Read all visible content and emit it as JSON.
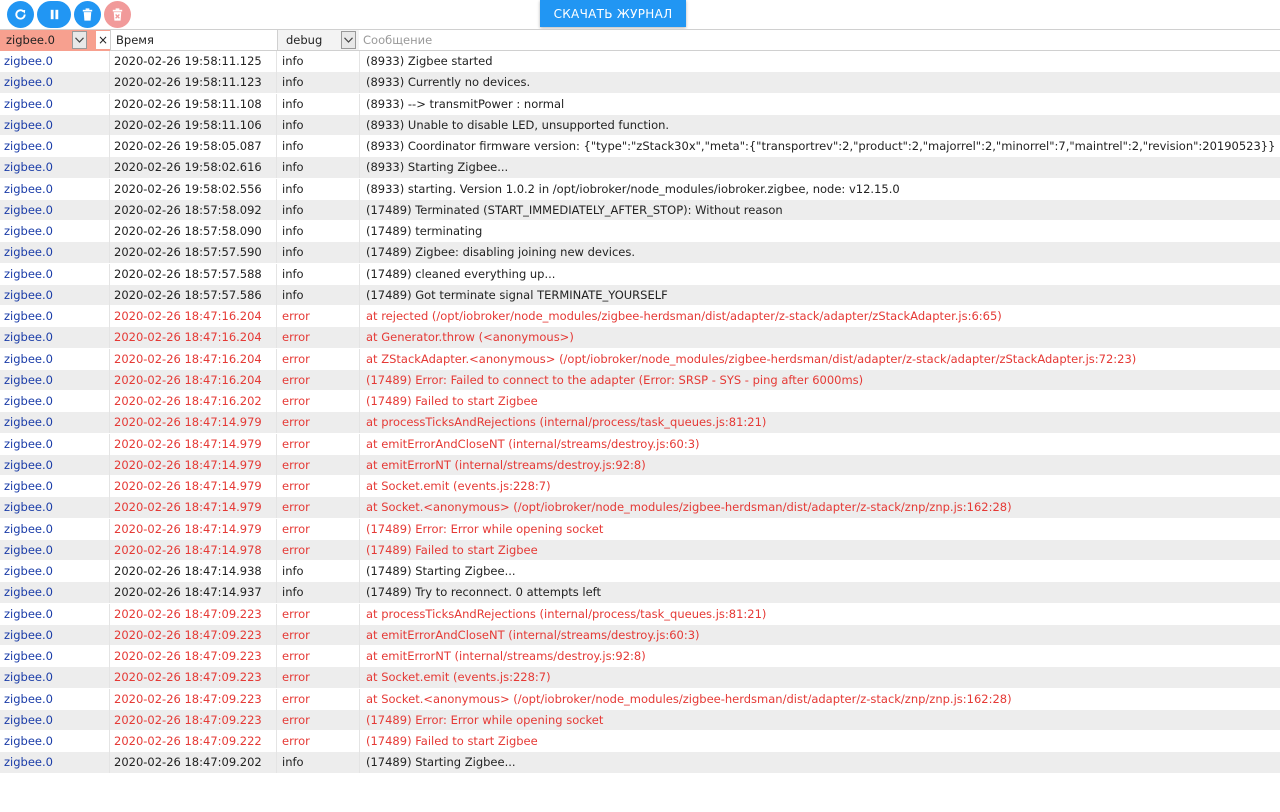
{
  "toolbar": {
    "download_label": "СКАЧАТЬ ЖУРНАЛ",
    "accent_color": "#2196f3",
    "delete_color": "#f19a9a",
    "icons": [
      "refresh-icon",
      "pause-icon",
      "trash-icon",
      "trash-cancel-icon"
    ]
  },
  "filters": {
    "source_value": "zigbee.0",
    "clear_glyph": "×",
    "time_header": "Время",
    "level_value": "debug",
    "message_placeholder": "Сообщение"
  },
  "colors": {
    "error": "#e53935",
    "source": "#1a3ca8"
  },
  "rows": [
    {
      "src": "zigbee.0",
      "time": "2020-02-26 19:58:11.125",
      "level": "info",
      "msg": "(8933) Zigbee started"
    },
    {
      "src": "zigbee.0",
      "time": "2020-02-26 19:58:11.123",
      "level": "info",
      "msg": "(8933) Currently no devices."
    },
    {
      "src": "zigbee.0",
      "time": "2020-02-26 19:58:11.108",
      "level": "info",
      "msg": "(8933) --> transmitPower : normal"
    },
    {
      "src": "zigbee.0",
      "time": "2020-02-26 19:58:11.106",
      "level": "info",
      "msg": "(8933) Unable to disable LED, unsupported function."
    },
    {
      "src": "zigbee.0",
      "time": "2020-02-26 19:58:05.087",
      "level": "info",
      "msg": "(8933) Coordinator firmware version: {\"type\":\"zStack30x\",\"meta\":{\"transportrev\":2,\"product\":2,\"majorrel\":2,\"minorrel\":7,\"maintrel\":2,\"revision\":20190523}}"
    },
    {
      "src": "zigbee.0",
      "time": "2020-02-26 19:58:02.616",
      "level": "info",
      "msg": "(8933) Starting Zigbee..."
    },
    {
      "src": "zigbee.0",
      "time": "2020-02-26 19:58:02.556",
      "level": "info",
      "msg": "(8933) starting. Version 1.0.2 in /opt/iobroker/node_modules/iobroker.zigbee, node: v12.15.0"
    },
    {
      "src": "zigbee.0",
      "time": "2020-02-26 18:57:58.092",
      "level": "info",
      "msg": "(17489) Terminated (START_IMMEDIATELY_AFTER_STOP): Without reason"
    },
    {
      "src": "zigbee.0",
      "time": "2020-02-26 18:57:58.090",
      "level": "info",
      "msg": "(17489) terminating"
    },
    {
      "src": "zigbee.0",
      "time": "2020-02-26 18:57:57.590",
      "level": "info",
      "msg": "(17489) Zigbee: disabling joining new devices."
    },
    {
      "src": "zigbee.0",
      "time": "2020-02-26 18:57:57.588",
      "level": "info",
      "msg": "(17489) cleaned everything up..."
    },
    {
      "src": "zigbee.0",
      "time": "2020-02-26 18:57:57.586",
      "level": "info",
      "msg": "(17489) Got terminate signal TERMINATE_YOURSELF"
    },
    {
      "src": "zigbee.0",
      "time": "2020-02-26 18:47:16.204",
      "level": "error",
      "msg": "at rejected (/opt/iobroker/node_modules/zigbee-herdsman/dist/adapter/z-stack/adapter/zStackAdapter.js:6:65)"
    },
    {
      "src": "zigbee.0",
      "time": "2020-02-26 18:47:16.204",
      "level": "error",
      "msg": "at Generator.throw (<anonymous>)"
    },
    {
      "src": "zigbee.0",
      "time": "2020-02-26 18:47:16.204",
      "level": "error",
      "msg": "at ZStackAdapter.<anonymous> (/opt/iobroker/node_modules/zigbee-herdsman/dist/adapter/z-stack/adapter/zStackAdapter.js:72:23)"
    },
    {
      "src": "zigbee.0",
      "time": "2020-02-26 18:47:16.204",
      "level": "error",
      "msg": "(17489) Error: Failed to connect to the adapter (Error: SRSP - SYS - ping after 6000ms)"
    },
    {
      "src": "zigbee.0",
      "time": "2020-02-26 18:47:16.202",
      "level": "error",
      "msg": "(17489) Failed to start Zigbee"
    },
    {
      "src": "zigbee.0",
      "time": "2020-02-26 18:47:14.979",
      "level": "error",
      "msg": "at processTicksAndRejections (internal/process/task_queues.js:81:21)"
    },
    {
      "src": "zigbee.0",
      "time": "2020-02-26 18:47:14.979",
      "level": "error",
      "msg": "at emitErrorAndCloseNT (internal/streams/destroy.js:60:3)"
    },
    {
      "src": "zigbee.0",
      "time": "2020-02-26 18:47:14.979",
      "level": "error",
      "msg": "at emitErrorNT (internal/streams/destroy.js:92:8)"
    },
    {
      "src": "zigbee.0",
      "time": "2020-02-26 18:47:14.979",
      "level": "error",
      "msg": "at Socket.emit (events.js:228:7)"
    },
    {
      "src": "zigbee.0",
      "time": "2020-02-26 18:47:14.979",
      "level": "error",
      "msg": "at Socket.<anonymous> (/opt/iobroker/node_modules/zigbee-herdsman/dist/adapter/z-stack/znp/znp.js:162:28)"
    },
    {
      "src": "zigbee.0",
      "time": "2020-02-26 18:47:14.979",
      "level": "error",
      "msg": "(17489) Error: Error while opening socket"
    },
    {
      "src": "zigbee.0",
      "time": "2020-02-26 18:47:14.978",
      "level": "error",
      "msg": "(17489) Failed to start Zigbee"
    },
    {
      "src": "zigbee.0",
      "time": "2020-02-26 18:47:14.938",
      "level": "info",
      "msg": "(17489) Starting Zigbee..."
    },
    {
      "src": "zigbee.0",
      "time": "2020-02-26 18:47:14.937",
      "level": "info",
      "msg": "(17489) Try to reconnect. 0 attempts left"
    },
    {
      "src": "zigbee.0",
      "time": "2020-02-26 18:47:09.223",
      "level": "error",
      "msg": "at processTicksAndRejections (internal/process/task_queues.js:81:21)"
    },
    {
      "src": "zigbee.0",
      "time": "2020-02-26 18:47:09.223",
      "level": "error",
      "msg": "at emitErrorAndCloseNT (internal/streams/destroy.js:60:3)"
    },
    {
      "src": "zigbee.0",
      "time": "2020-02-26 18:47:09.223",
      "level": "error",
      "msg": "at emitErrorNT (internal/streams/destroy.js:92:8)"
    },
    {
      "src": "zigbee.0",
      "time": "2020-02-26 18:47:09.223",
      "level": "error",
      "msg": "at Socket.emit (events.js:228:7)"
    },
    {
      "src": "zigbee.0",
      "time": "2020-02-26 18:47:09.223",
      "level": "error",
      "msg": "at Socket.<anonymous> (/opt/iobroker/node_modules/zigbee-herdsman/dist/adapter/z-stack/znp/znp.js:162:28)"
    },
    {
      "src": "zigbee.0",
      "time": "2020-02-26 18:47:09.223",
      "level": "error",
      "msg": "(17489) Error: Error while opening socket"
    },
    {
      "src": "zigbee.0",
      "time": "2020-02-26 18:47:09.222",
      "level": "error",
      "msg": "(17489) Failed to start Zigbee"
    },
    {
      "src": "zigbee.0",
      "time": "2020-02-26 18:47:09.202",
      "level": "info",
      "msg": "(17489) Starting Zigbee..."
    }
  ]
}
